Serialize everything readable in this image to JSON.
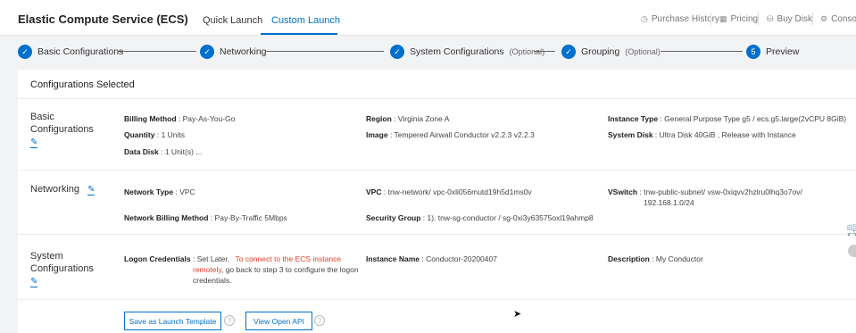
{
  "header": {
    "app_title": "Elastic Compute Service (ECS)",
    "tabs": [
      "Quick Launch",
      "Custom Launch"
    ],
    "links": [
      "Purchase History",
      "Pricing",
      "Buy Disk",
      "Console"
    ]
  },
  "steps": [
    {
      "label": "Basic Configurations",
      "optional": ""
    },
    {
      "label": "Networking",
      "optional": ""
    },
    {
      "label": "System Configurations",
      "optional": "(Optional)"
    },
    {
      "label": "Grouping",
      "optional": "(Optional)"
    },
    {
      "label": "Preview",
      "optional": "",
      "number": "5"
    }
  ],
  "card": {
    "title": "Configurations Selected",
    "sections": {
      "basic": {
        "title_line1": "Basic",
        "title_line2": "Configurations",
        "billing_method_k": "Billing Method",
        "billing_method_v": "Pay-As-You-Go",
        "quantity_k": "Quantity",
        "quantity_v": "1 Units",
        "data_disk_k": "Data Disk",
        "data_disk_v": "1 Unit(s) ...",
        "region_k": "Region",
        "region_v": "Virginia Zone A",
        "image_k": "Image",
        "image_v": "Tempered Airwall Conductor v2.2.3 v2.2.3",
        "instance_type_k": "Instance Type",
        "instance_type_v": "General Purpose Type g5 / ecs.g5.large(2vCPU 8GiB)",
        "system_disk_k": "System Disk",
        "system_disk_v": "Ultra Disk 40GiB , Release with Instance"
      },
      "networking": {
        "title": "Networking",
        "network_type_k": "Network Type",
        "network_type_v": "VPC",
        "network_billing_k": "Network Billing Method",
        "network_billing_v": "Pay-By-Traffic 5Mbps",
        "vpc_k": "VPC",
        "vpc_v": "tnw-network/ vpc-0xli056mutd19h5d1ms0v",
        "sg_k": "Security Group",
        "sg_v": "1). tnw-sg-conductor / sg-0xi3y63575oxl19ahmp8",
        "vswitch_k": "VSwitch",
        "vswitch_v1": "tnw-public-subnet/ vsw-0xiqvv2hzlru0lhq3o7ov/",
        "vswitch_v2": "192.168.1.0/24"
      },
      "system": {
        "title_line1": "System",
        "title_line2": "Configurations",
        "logon_k": "Logon Credentials",
        "logon_v": "Set Later.",
        "logon_red1": "To connect to the ECS instance",
        "logon_red2": "remotely",
        "logon_rest1": ", go back to step 3 to configure the logon",
        "logon_rest2": "credentials.",
        "instance_name_k": "Instance Name",
        "instance_name_v": "Conductor-20200407",
        "description_k": "Description",
        "description_v": "My Conductor"
      }
    }
  },
  "buttons": {
    "save_template": "Save as Launch Template",
    "view_api": "View Open API"
  },
  "colors": {
    "accent": "#0070cc",
    "warning_text": "#e5412a",
    "cart": "#f08a00"
  }
}
